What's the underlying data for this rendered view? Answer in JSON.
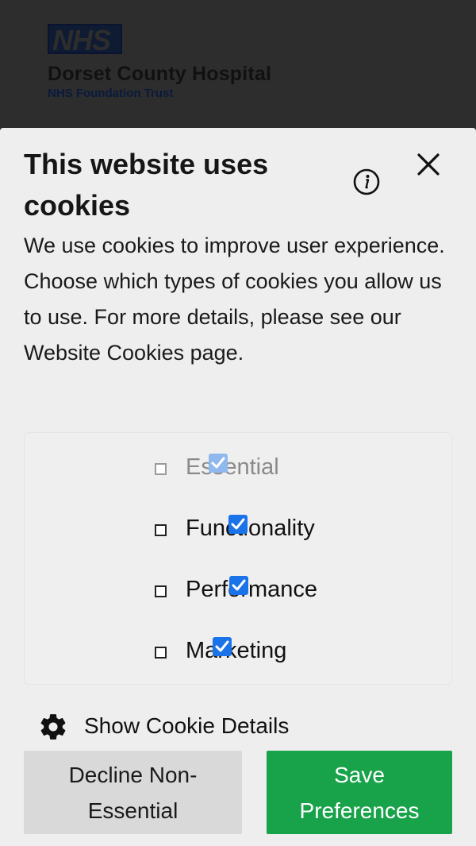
{
  "header": {
    "logo_text": "NHS",
    "org_name": "Dorset County Hospital",
    "org_sub": "NHS Foundation Trust"
  },
  "cookie_panel": {
    "title": "This website uses cookies",
    "intro": "We use cookies to improve user experience. Choose which types of cookies you allow us to use. For more details, please see our Website Cookies page.",
    "options": [
      {
        "label": "Essential",
        "checked": true,
        "disabled": true
      },
      {
        "label": "Functionality",
        "checked": true,
        "disabled": false
      },
      {
        "label": "Performance",
        "checked": true,
        "disabled": false
      },
      {
        "label": "Marketing",
        "checked": true,
        "disabled": false
      }
    ],
    "details_label": "Show Cookie Details",
    "decline_label": "Decline Non-Essential",
    "save_label": "Save Preferences"
  },
  "colors": {
    "accent_green": "#18a24a",
    "checkbox_blue": "#1a73e8",
    "panel_bg": "#eeeeee",
    "header_bg": "#2d2d2d"
  }
}
